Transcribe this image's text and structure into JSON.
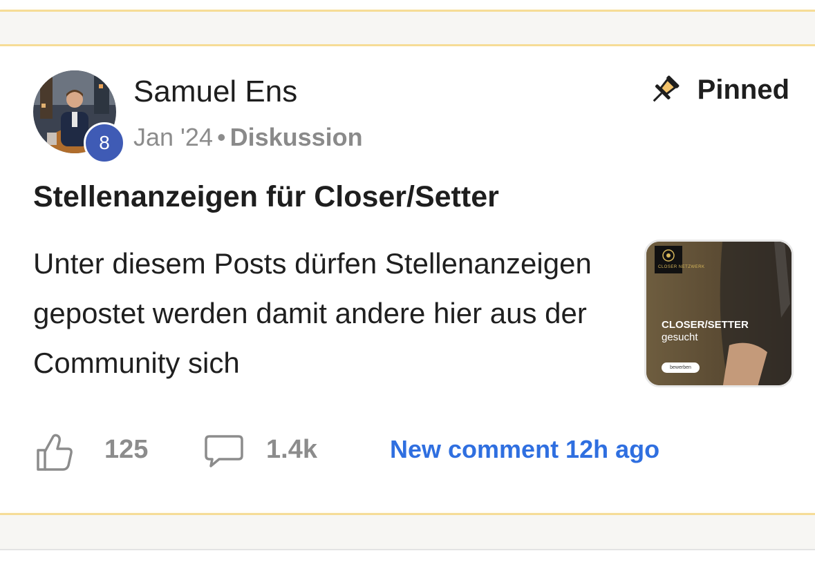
{
  "post": {
    "author": "Samuel Ens",
    "level": "8",
    "date": "Jan '24",
    "separator": "•",
    "category": "Diskussion",
    "pinned_label": "Pinned",
    "title": "Stellenanzeigen für Closer/Setter",
    "excerpt": "Unter diesem Posts dürfen Stellenanzeigen gepostet werden damit andere hier aus der Community sich",
    "thumbnail": {
      "logo_text": "CLOSER NETZWERK",
      "headline": "CLOSER/SETTER",
      "subline": "gesucht",
      "button": "bewerben"
    },
    "likes": "125",
    "comments": "1.4k",
    "new_comment": "New comment 12h ago"
  },
  "colors": {
    "accent_blue": "#2f6fe0",
    "badge_blue": "#3f5bb5",
    "gold_separator": "#f6dc96"
  },
  "icons": {
    "pin": "pushpin-icon",
    "like": "thumbs-up-icon",
    "comment": "speech-bubble-icon"
  }
}
